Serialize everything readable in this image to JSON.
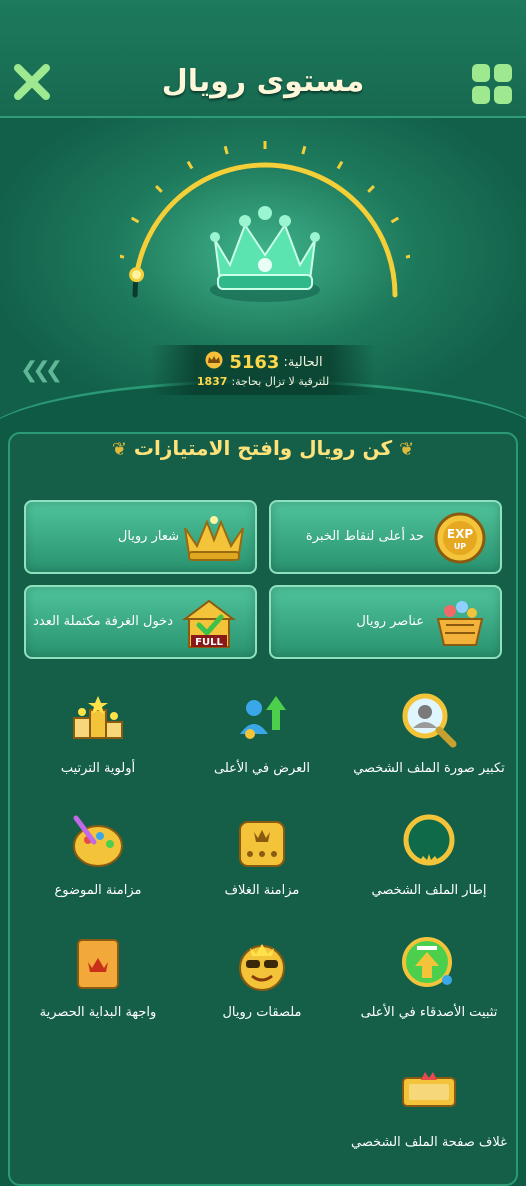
{
  "header": {
    "title": "مستوى رويال"
  },
  "royal_status": {
    "current_label": "الحالية:",
    "current_points": "5163",
    "upgrade_label": "للترقية لا تزال بحاجة:",
    "upgrade_needed": "1837",
    "progress_fraction": 0.05
  },
  "section": {
    "title": "كن رويال وافتح الامتيازات"
  },
  "cards": [
    {
      "label": "حد أعلى لنقاط الخبرة",
      "icon": "exp-up-icon"
    },
    {
      "label": "شعار رويال",
      "icon": "royal-crown-icon"
    },
    {
      "label": "عناصر رويال",
      "icon": "royal-items-basket-icon"
    },
    {
      "label": "دخول الغرفة مكتملة العدد",
      "icon": "full-room-icon"
    }
  ],
  "features": [
    {
      "label": "تكبير صورة الملف الشخصي",
      "icon": "magnify-avatar-icon"
    },
    {
      "label": "العرض في الأعلى",
      "icon": "top-display-icon"
    },
    {
      "label": "أولوية الترتيب",
      "icon": "podium-icon"
    },
    {
      "label": "إطار الملف الشخصي",
      "icon": "avatar-frame-icon"
    },
    {
      "label": "مزامنة الغلاف",
      "icon": "dice-icon"
    },
    {
      "label": "مزامنة الموضوع",
      "icon": "theme-palette-icon"
    },
    {
      "label": "تثبيت الأصدقاء في الأعلى",
      "icon": "pin-friends-icon"
    },
    {
      "label": "ملصقات رويال",
      "icon": "royal-sticker-icon"
    },
    {
      "label": "واجهة البداية الحصرية",
      "icon": "splash-screen-icon"
    },
    {
      "label": "غلاف صفحة الملف الشخصي",
      "icon": "profile-cover-icon"
    }
  ],
  "colors": {
    "accent_gold": "#ffd84a",
    "panel_green": "#155f48",
    "card_green": "#3fb28a"
  }
}
